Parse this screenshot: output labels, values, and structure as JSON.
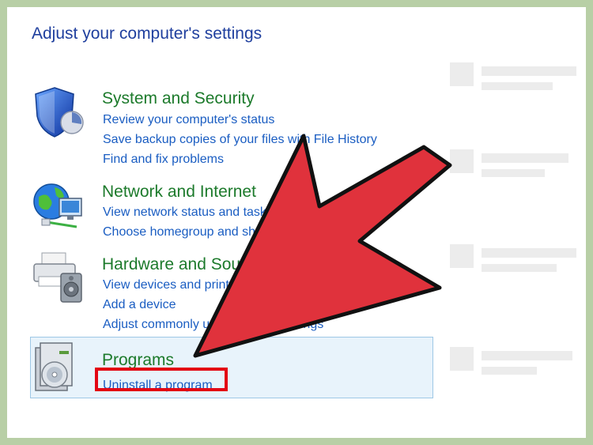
{
  "heading": "Adjust your computer's settings",
  "categories": [
    {
      "title": "System and Security",
      "icon": "shield-icon",
      "links": [
        "Review your computer's status",
        "Save backup copies of your files with File History",
        "Find and fix problems"
      ]
    },
    {
      "title": "Network and Internet",
      "icon": "network-globe-icon",
      "links": [
        "View network status and tasks",
        "Choose homegroup and sharing options"
      ]
    },
    {
      "title": "Hardware and Sound",
      "icon": "printer-speaker-icon",
      "links": [
        "View devices and printers",
        "Add a device",
        "Adjust commonly used mobility settings"
      ]
    },
    {
      "title": "Programs",
      "icon": "programs-disc-icon",
      "links": [
        "Uninstall a program"
      ]
    }
  ],
  "colors": {
    "border": "#b8cfa6",
    "heading": "#1f3f9e",
    "category_title": "#1c7a2b",
    "link": "#1a5dc2",
    "highlight_box": "#e8f3fb",
    "red_box": "#e30613",
    "arrow": "#e0323c"
  }
}
